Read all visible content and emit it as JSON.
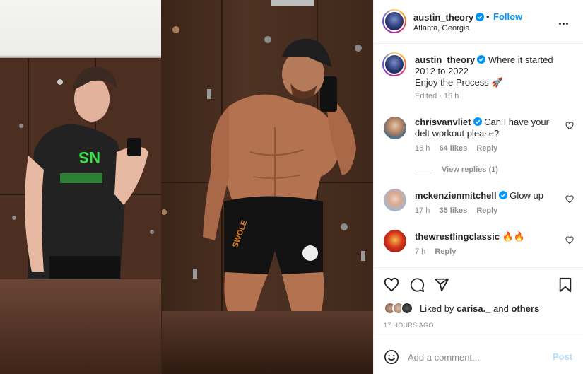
{
  "post": {
    "author": "austin_theory",
    "location": "Atlanta, Georgia",
    "follow_label": "Follow",
    "separator": "•",
    "caption_line1": "Where it started",
    "caption_line2": "2012 to 2022",
    "caption_line3": "Enjoy the Process 🚀",
    "caption_meta": "Edited · 16 h"
  },
  "comments": [
    {
      "user": "chrisvanvliet",
      "text_line1": "Can I have your",
      "text_line2": "delt workout please?",
      "age": "16 h",
      "likes": "64 likes",
      "reply": "Reply",
      "verified": true
    },
    {
      "user": "mckenzienmitchell",
      "text_line1": "Glow up",
      "age": "17 h",
      "likes": "35 likes",
      "reply": "Reply",
      "verified": true
    },
    {
      "user": "thewrestlingclassic",
      "text_line1": "🔥🔥",
      "age": "7 h",
      "reply": "Reply",
      "verified": false
    }
  ],
  "view_replies": "View replies (1)",
  "likes": {
    "prefix": "Liked by",
    "user": "carisa._",
    "joiner": "and",
    "others": "others"
  },
  "timestamp": "17 HOURS AGO",
  "add_comment": {
    "placeholder": "Add a comment...",
    "post_label": "Post"
  },
  "icons": {
    "like": "heart-icon",
    "comment": "comment-icon",
    "share": "paper-plane-icon",
    "save": "bookmark-icon",
    "emoji": "smiley-icon",
    "more": "more-options-icon",
    "verified": "verified-badge-icon"
  },
  "colors": {
    "accent": "#0095f6",
    "post_disabled": "#b2dffc",
    "muted": "#8e8e8e",
    "text": "#262626"
  }
}
